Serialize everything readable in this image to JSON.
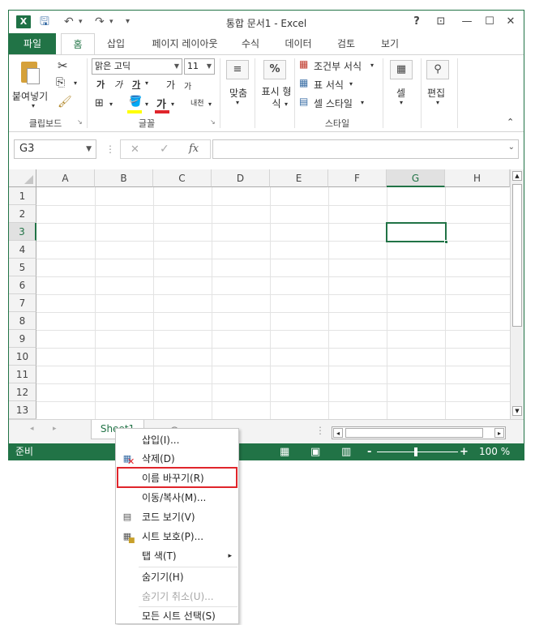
{
  "window": {
    "title": "통합 문서1 - Excel",
    "app_icon": "X",
    "help_glyph": "?",
    "restore_ribbon_glyph": "⊡",
    "minimize_glyph": "—",
    "maximize_glyph": "☐",
    "close_glyph": "✕"
  },
  "qat": {
    "save_glyph": "🖫",
    "undo_glyph": "↶",
    "redo_glyph": "↷",
    "customize_glyph": "▾"
  },
  "tabs": [
    {
      "label": "파일"
    },
    {
      "label": "홈"
    },
    {
      "label": "삽입"
    },
    {
      "label": "페이지 레이아웃"
    },
    {
      "label": "수식"
    },
    {
      "label": "데이터"
    },
    {
      "label": "검토"
    },
    {
      "label": "보기"
    }
  ],
  "ribbon": {
    "clipboard": {
      "paste_label": "붙여넣기",
      "group_label": "클립보드"
    },
    "font": {
      "font_name": "맑은 고딕",
      "font_size": "11",
      "grow_label": "가",
      "shrink_label": "가",
      "bold_label": "가",
      "italic_label": "가",
      "underline_label": "가",
      "font_color_label": "가",
      "phonetic_label": "내천",
      "group_label": "글꼴"
    },
    "alignment": {
      "label": "맞춤"
    },
    "number": {
      "label": "표시 형식"
    },
    "styles": {
      "conditional_label": "조건부 서식",
      "table_label": "표 서식",
      "cell_style_label": "셀 스타일",
      "group_label": "스타일"
    },
    "cells": {
      "label": "셀"
    },
    "editing": {
      "label": "편집"
    }
  },
  "formula_bar": {
    "name_box_value": "G3",
    "cancel_glyph": "✕",
    "enter_glyph": "✓",
    "fx_label": "fx",
    "formula_value": ""
  },
  "grid": {
    "columns": [
      "A",
      "B",
      "C",
      "D",
      "E",
      "F",
      "G",
      "H"
    ],
    "rows": [
      "1",
      "2",
      "3",
      "4",
      "5",
      "6",
      "7",
      "8",
      "9",
      "10",
      "11",
      "12",
      "13"
    ],
    "selected_column": "G",
    "selected_row": "3"
  },
  "sheet_tabs": {
    "sheets": [
      "Sheet1"
    ],
    "add_glyph": "⊕"
  },
  "status": {
    "ready": "준비",
    "zoom": "100 %"
  },
  "context_menu": {
    "items": [
      {
        "label": "삽입(I)...",
        "icon": "",
        "enabled": true
      },
      {
        "label": "삭제(D)",
        "icon": "delete-sheet-icon",
        "enabled": true
      },
      {
        "label": "이름 바꾸기(R)",
        "icon": "",
        "enabled": true,
        "highlighted": true
      },
      {
        "label": "이동/복사(M)...",
        "icon": "",
        "enabled": true
      },
      {
        "label": "코드 보기(V)",
        "icon": "view-code-icon",
        "enabled": true
      },
      {
        "label": "시트 보호(P)...",
        "icon": "protect-sheet-icon",
        "enabled": true
      },
      {
        "label": "탭 색(T)",
        "icon": "",
        "enabled": true,
        "submenu": true
      },
      {
        "label": "숨기기(H)",
        "icon": "",
        "enabled": true
      },
      {
        "label": "숨기기 취소(U)...",
        "icon": "",
        "enabled": false
      },
      {
        "label": "모든 시트 선택(S)",
        "icon": "",
        "enabled": true
      }
    ],
    "submenu_glyph": "▸"
  },
  "colors": {
    "accent": "#217346",
    "highlight": "#e0252b"
  }
}
